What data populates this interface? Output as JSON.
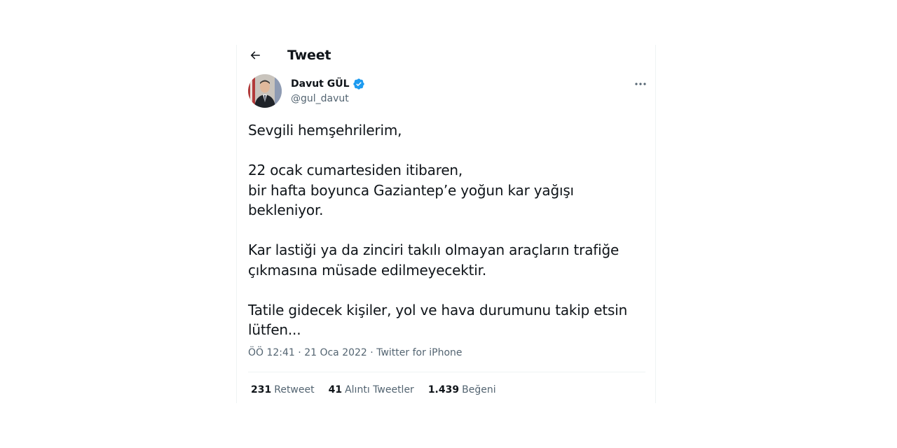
{
  "header": {
    "title": "Tweet",
    "back_icon": "arrow-left-icon"
  },
  "author": {
    "display_name": "Davut GÜL",
    "username": "@gul_davut",
    "verified_icon": "verified-badge-icon",
    "verified_color": "#1d9bf0",
    "more_icon": "more-horizontal-icon"
  },
  "tweet": {
    "paragraphs": [
      [
        "Sevgili hemşehrilerim,"
      ],
      [
        "22 ocak cumartesiden itibaren,",
        "bir hafta boyunca Gaziantep’e yoğun kar yağışı bekleniyor."
      ],
      [
        "Kar lastiği ya da zinciri takılı olmayan araçların trafiğe",
        "çıkmasına müsade edilmeyecektir."
      ],
      [
        "Tatile gidecek kişiler, yol ve hava durumunu takip etsin",
        "lütfen..."
      ]
    ]
  },
  "meta": {
    "time": "ÖÖ 12:41",
    "separator": " · ",
    "date": "21 Oca 2022",
    "source": "Twitter for iPhone"
  },
  "stats": {
    "retweets_count": "231",
    "retweets_label": "Retweet",
    "quotes_count": "41",
    "quotes_label": "Alıntı Tweetler",
    "likes_count": "1.439",
    "likes_label": "Beğeni"
  },
  "colors": {
    "text_primary": "#0f1419",
    "text_secondary": "#536471",
    "border": "#eff3f4"
  }
}
